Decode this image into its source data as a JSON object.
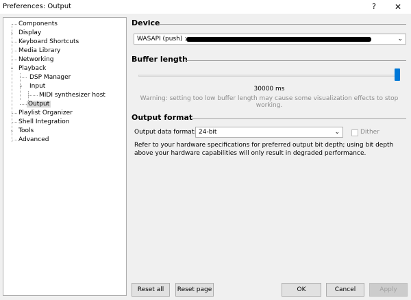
{
  "window": {
    "title": "Preferences: Output",
    "help_glyph": "?",
    "close_glyph": "✕"
  },
  "tree": {
    "items": [
      {
        "label": "Components"
      },
      {
        "label": "Display",
        "twisty": "›"
      },
      {
        "label": "Keyboard Shortcuts"
      },
      {
        "label": "Media Library"
      },
      {
        "label": "Networking"
      },
      {
        "label": "Playback",
        "twisty": "⌄"
      },
      {
        "label": "DSP Manager"
      },
      {
        "label": "Input",
        "twisty": "⌄"
      },
      {
        "label": "MIDI synthesizer host"
      },
      {
        "label": "Output",
        "selected": true
      },
      {
        "label": "Playlist Organizer"
      },
      {
        "label": "Shell Integration"
      },
      {
        "label": "Tools",
        "twisty": "›"
      },
      {
        "label": "Advanced"
      }
    ]
  },
  "device": {
    "heading": "Device",
    "value": "WASAPI (push) :",
    "arrow": "⌄"
  },
  "buffer": {
    "heading": "Buffer length",
    "slider_fraction": 1.0,
    "value_text": "30000 ms",
    "warning": "Warning: setting too low buffer length may cause some visualization effects to stop working."
  },
  "output_format": {
    "heading": "Output format",
    "data_format_label": "Output data format:",
    "data_format_value": "24-bit",
    "arrow": "⌄",
    "dither_label": "Dither",
    "dither_checked": false,
    "info": "Refer to your hardware specifications for preferred output bit depth; using bit depth above your hardware capabilities will only result in degraded performance."
  },
  "buttons": {
    "reset_all": "Reset all",
    "reset_page": "Reset page",
    "ok": "OK",
    "cancel": "Cancel",
    "apply": "Apply"
  },
  "colors": {
    "accent": "#0078d7",
    "selection": "#d9d9d9"
  }
}
